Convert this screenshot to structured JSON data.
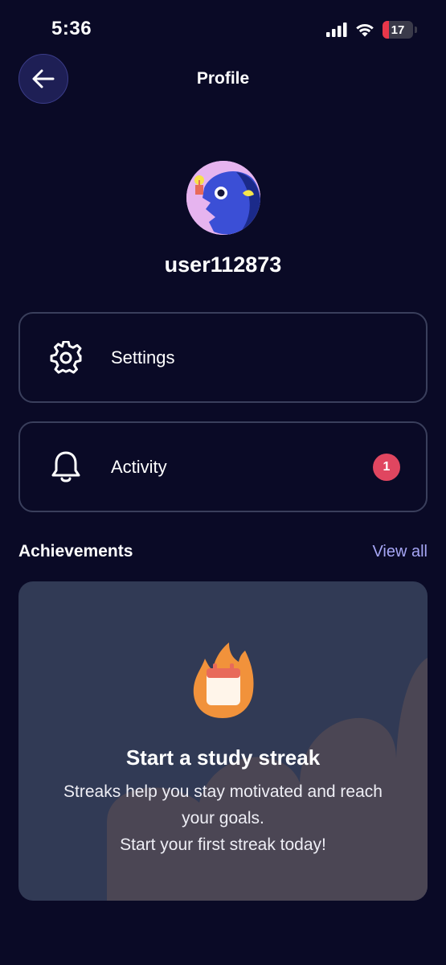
{
  "status_bar": {
    "time": "5:36",
    "battery_level": "17"
  },
  "header": {
    "title": "Profile"
  },
  "profile": {
    "username": "user112873"
  },
  "menu": {
    "settings_label": "Settings",
    "activity_label": "Activity",
    "activity_badge": "1"
  },
  "achievements": {
    "title": "Achievements",
    "view_all": "View all",
    "card_title": "Start a study streak",
    "card_line1": "Streaks help you stay motivated and reach",
    "card_line2": "your goals.",
    "card_line3": "Start your first streak today!"
  },
  "colors": {
    "background": "#0a0a26",
    "accent_link": "#a6a6f5",
    "badge": "#e04660",
    "card": "#313a55"
  },
  "icons": [
    "back-arrow-icon",
    "gear-icon",
    "bell-icon",
    "flame-calendar-icon",
    "wifi-icon",
    "signal-icon",
    "battery-icon"
  ]
}
